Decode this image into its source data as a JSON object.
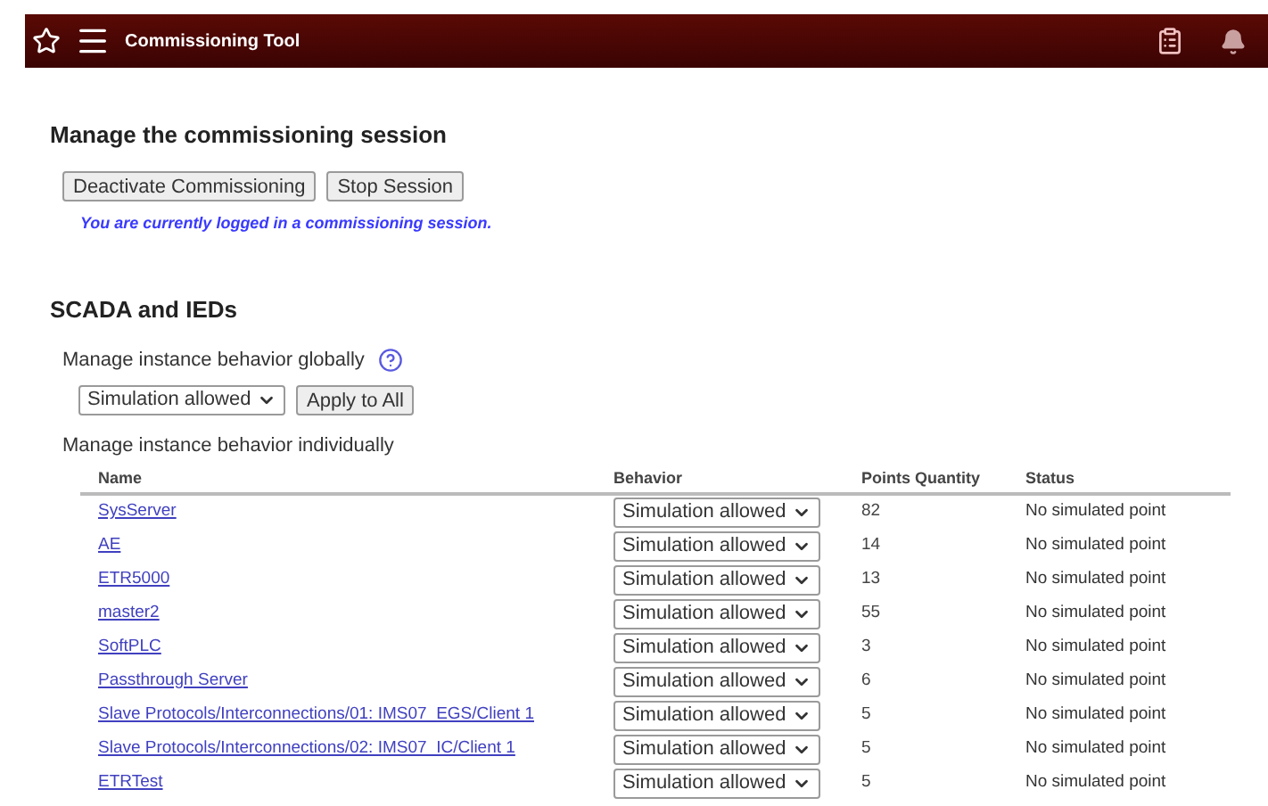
{
  "header": {
    "title": "Commissioning Tool"
  },
  "session": {
    "heading": "Manage the commissioning session",
    "buttons": [
      "Deactivate Commissioning",
      "Stop Session"
    ],
    "notice": "You are currently logged in a commissioning session."
  },
  "scada": {
    "heading": "SCADA and IEDs",
    "global_label": "Manage instance behavior globally",
    "global_select": "Simulation allowed",
    "apply_button": "Apply to All",
    "individual_label": "Manage instance behavior individually",
    "table": {
      "columns": [
        "Name",
        "Behavior",
        "Points Quantity",
        "Status"
      ],
      "rows": [
        {
          "name": "SysServer",
          "behavior": "Simulation allowed",
          "points": "82",
          "status": "No simulated point"
        },
        {
          "name": "AE",
          "behavior": "Simulation allowed",
          "points": "14",
          "status": "No simulated point"
        },
        {
          "name": "ETR5000",
          "behavior": "Simulation allowed",
          "points": "13",
          "status": "No simulated point"
        },
        {
          "name": "master2",
          "behavior": "Simulation allowed",
          "points": "55",
          "status": "No simulated point"
        },
        {
          "name": "SoftPLC",
          "behavior": "Simulation allowed",
          "points": "3",
          "status": "No simulated point"
        },
        {
          "name": "Passthrough Server",
          "behavior": "Simulation allowed",
          "points": "6",
          "status": "No simulated point"
        },
        {
          "name": "Slave Protocols/Interconnections/01: IMS07_EGS/Client 1",
          "behavior": "Simulation allowed",
          "points": "5",
          "status": "No simulated point"
        },
        {
          "name": "Slave Protocols/Interconnections/02: IMS07_IC/Client 1",
          "behavior": "Simulation allowed",
          "points": "5",
          "status": "No simulated point"
        },
        {
          "name": "ETRTest",
          "behavior": "Simulation allowed",
          "points": "5",
          "status": "No simulated point"
        }
      ]
    }
  }
}
